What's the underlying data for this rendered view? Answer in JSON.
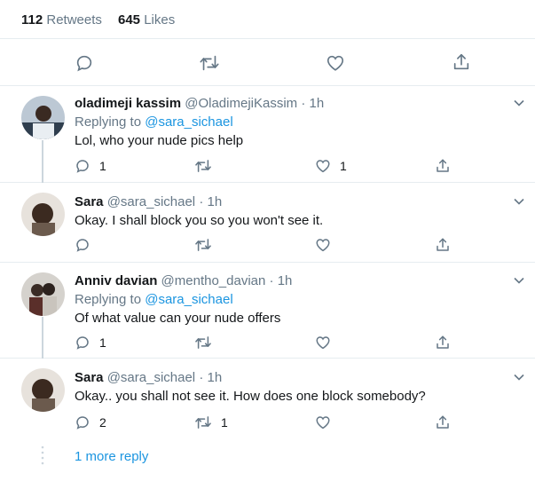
{
  "stats": {
    "retweets_count": "112",
    "retweets_label": "Retweets",
    "likes_count": "645",
    "likes_label": "Likes"
  },
  "icons": {
    "reply": "reply-icon",
    "retweet": "retweet-icon",
    "like": "heart-icon",
    "share": "share-icon",
    "caret": "chevron-down-icon"
  },
  "colors": {
    "link": "#1b95e0",
    "muted": "#657786",
    "text": "#14171a",
    "divider": "#e6ecf0"
  },
  "replies": [
    {
      "name": "oladimeji kassim",
      "handle": "@OladimejiKassim",
      "time": "1h",
      "replying_label": "Replying to",
      "replying_to": "@sara_sichael",
      "text": "Lol, who your nude pics help",
      "reply_count": "1",
      "retweet_count": "",
      "like_count": "1"
    },
    {
      "name": "Sara",
      "handle": "@sara_sichael",
      "time": "1h",
      "text": "Okay. I shall block you so you won't see it.",
      "reply_count": "",
      "retweet_count": "",
      "like_count": ""
    },
    {
      "name": "Anniv davian",
      "handle": "@mentho_davian",
      "time": "1h",
      "replying_label": "Replying to",
      "replying_to": "@sara_sichael",
      "text": "Of what value can your nude offers",
      "reply_count": "1",
      "retweet_count": "",
      "like_count": ""
    },
    {
      "name": "Sara",
      "handle": "@sara_sichael",
      "time": "1h",
      "text": "Okay.. you shall not see it. How does one block somebody?",
      "reply_count": "2",
      "retweet_count": "1",
      "like_count": ""
    }
  ],
  "more_replies": "1 more reply"
}
